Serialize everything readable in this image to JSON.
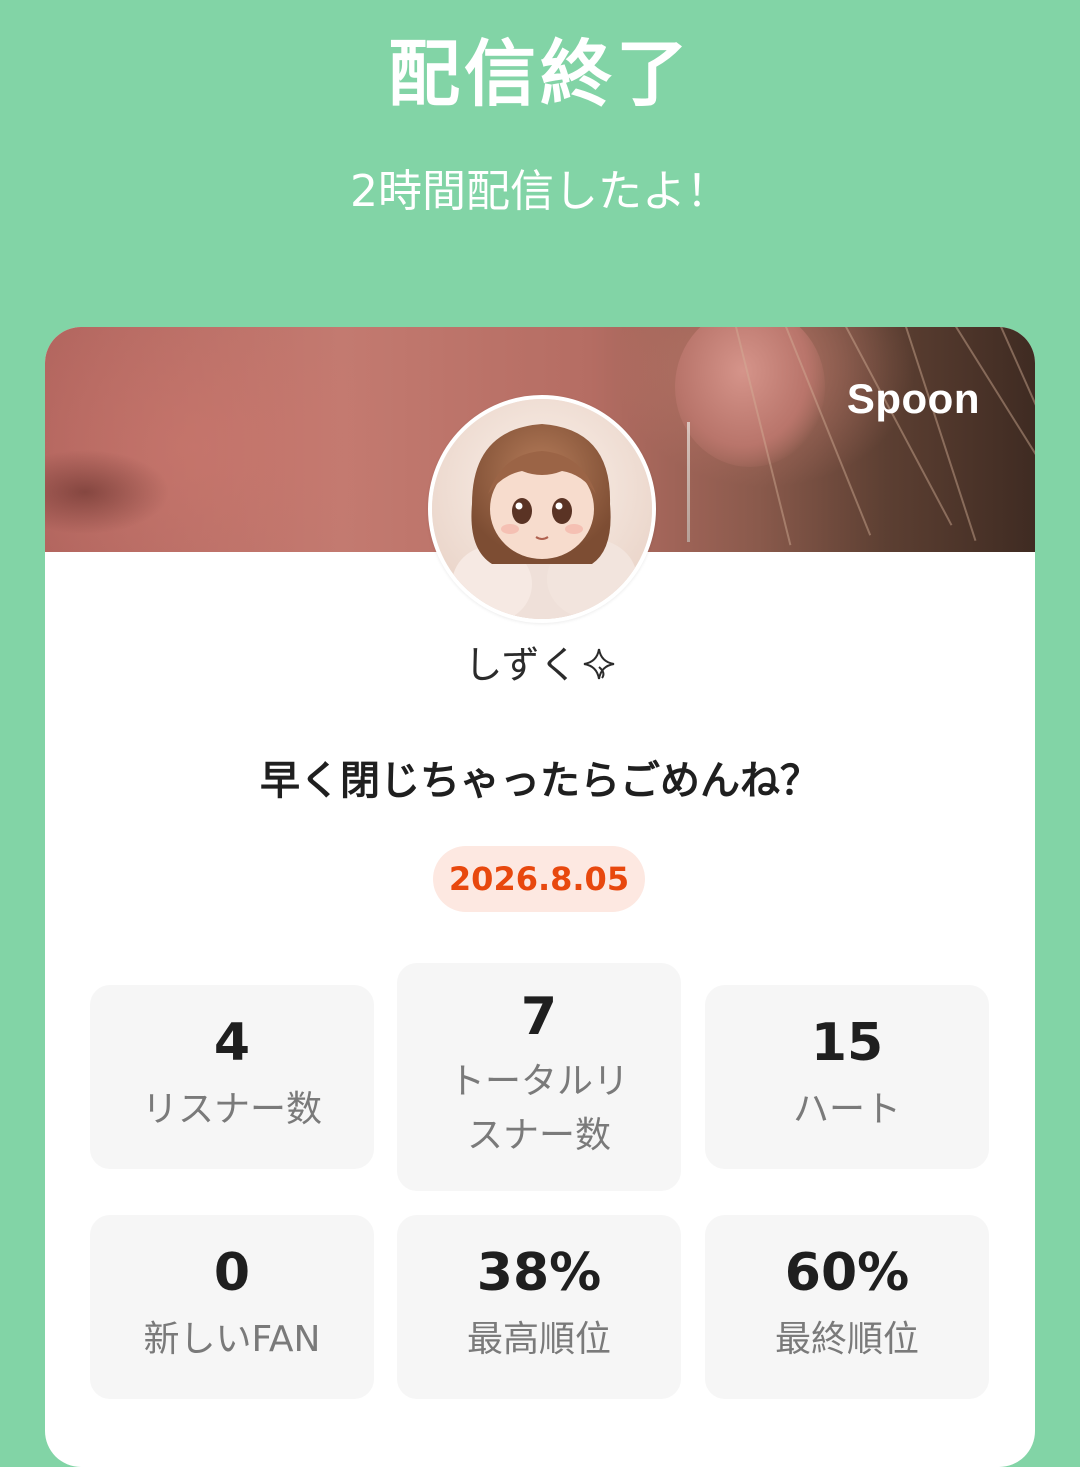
{
  "header": {
    "title": "配信終了",
    "subtitle": "2時間配信したよ！"
  },
  "card": {
    "brand": "Spoon",
    "username": "しずく",
    "sparkle_icon": "sparkle-icon",
    "room_title": "早く閉じちゃったらごめんね？",
    "date": "2026.8.05",
    "accent_color": "#e8480e",
    "background_color": "#82d4a6"
  },
  "stats": [
    {
      "value": "4",
      "label": "リスナー数"
    },
    {
      "value": "7",
      "label": "トータルリスナー数"
    },
    {
      "value": "15",
      "label": "ハート"
    },
    {
      "value": "0",
      "label": "新しいFAN"
    },
    {
      "value": "38%",
      "label": "最高順位"
    },
    {
      "value": "60%",
      "label": "最終順位"
    }
  ]
}
